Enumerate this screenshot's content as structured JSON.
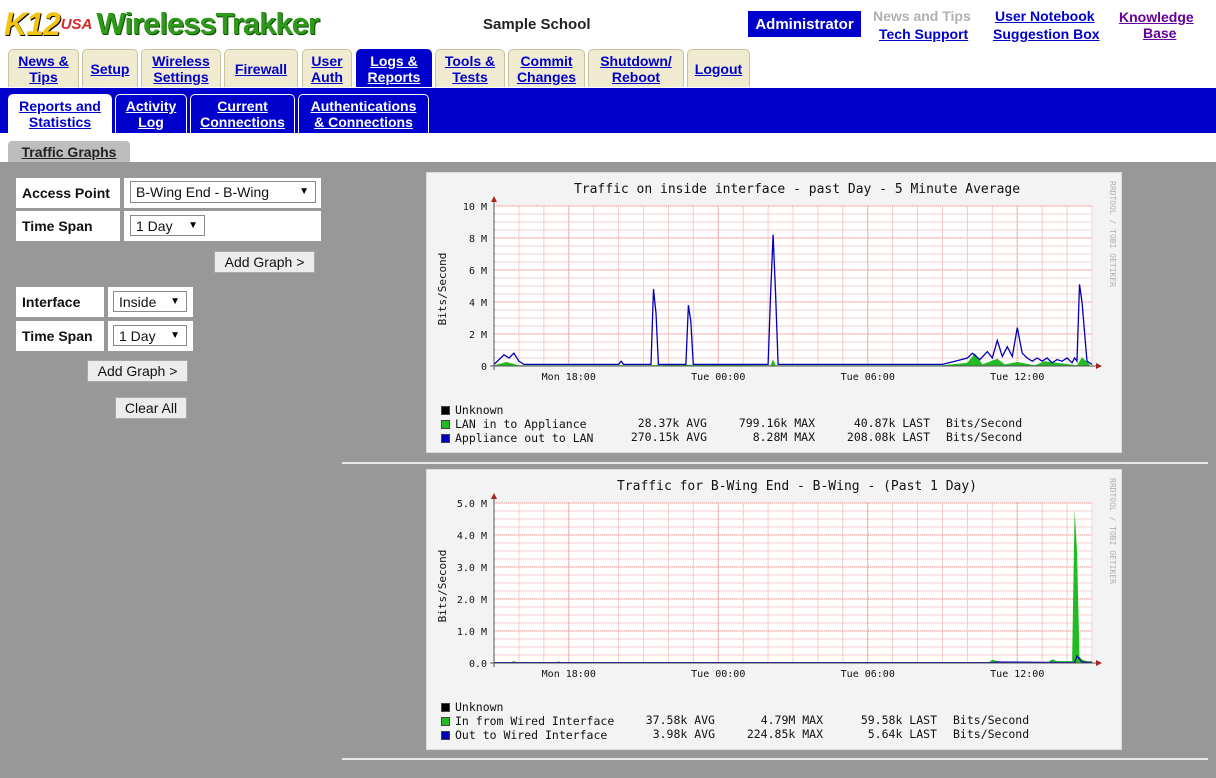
{
  "header": {
    "logo_k12": "K12",
    "logo_usa": "USA",
    "logo_product": "WirelessTrakker",
    "school": "Sample School",
    "user_role": "Administrator",
    "links": {
      "news_tips": "News and Tips",
      "tech_support": "Tech Support",
      "user_notebook": "User Notebook",
      "suggestion_box": "Suggestion Box",
      "knowledge_base_1": "Knowledge",
      "knowledge_base_2": "Base"
    }
  },
  "main_tabs": [
    {
      "line1": "News &",
      "line2": "Tips"
    },
    {
      "line1": "Setup",
      "line2": ""
    },
    {
      "line1": "Wireless",
      "line2": "Settings"
    },
    {
      "line1": "Firewall",
      "line2": ""
    },
    {
      "line1": "User",
      "line2": "Auth"
    },
    {
      "line1": "Logs &",
      "line2": "Reports",
      "active": true
    },
    {
      "line1": "Tools &",
      "line2": "Tests"
    },
    {
      "line1": "Commit",
      "line2": "Changes"
    },
    {
      "line1": "Shutdown/",
      "line2": "Reboot"
    },
    {
      "line1": "Logout",
      "line2": ""
    }
  ],
  "sub_tabs": [
    {
      "line1": "Reports and",
      "line2": "Statistics",
      "active": true
    },
    {
      "line1": "Activity",
      "line2": "Log"
    },
    {
      "line1": "Current",
      "line2": "Connections"
    },
    {
      "line1": "Authentications",
      "line2": "& Connections"
    }
  ],
  "section_tab": "Traffic Graphs",
  "form": {
    "access_point_label": "Access Point",
    "access_point_value": "B-Wing End - B-Wing",
    "time_span_label": "Time Span",
    "time_span_1_value": "1 Day",
    "add_graph_1": "Add Graph >",
    "interface_label": "Interface",
    "interface_value": "Inside",
    "time_span_2_value": "1 Day",
    "add_graph_2": "Add Graph >",
    "clear_all": "Clear All"
  },
  "colors": {
    "brand_blue": "#0000cc",
    "tab_bg": "#f0ebd0",
    "content_bg": "#989898",
    "series_green": "#22bb22",
    "series_blue": "#0000bb",
    "series_black": "#000000",
    "grid_red": "#f0b0b0",
    "axis_red": "#aa2222"
  },
  "chart_data": [
    {
      "type": "area",
      "title": "Traffic on inside interface - past Day - 5 Minute Average",
      "ylabel": "Bits/Second",
      "watermark": "RRDTOOL / TOBI OETIKER",
      "x_ticks": [
        "Mon 18:00",
        "Tue 00:00",
        "Tue 06:00",
        "Tue 12:00"
      ],
      "y_ticks": [
        "0",
        "2 M",
        "4 M",
        "6 M",
        "8 M",
        "10 M"
      ],
      "ylim": [
        0,
        10
      ],
      "xlim": [
        0,
        24
      ],
      "grid": true,
      "legend": [
        {
          "name": "Unknown",
          "color": "#000000",
          "avg": "",
          "max": "",
          "last": "",
          "unit": ""
        },
        {
          "name": "LAN in to Appliance",
          "color": "#22bb22",
          "avg": "28.37k AVG",
          "max": "799.16k MAX",
          "last": "40.87k LAST",
          "unit": "Bits/Second"
        },
        {
          "name": "Appliance out to LAN",
          "color": "#0000bb",
          "avg": "270.15k AVG",
          "max": "8.28M MAX",
          "last": "208.08k LAST",
          "unit": "Bits/Second"
        }
      ],
      "series": [
        {
          "name": "LAN in to Appliance",
          "color": "#22bb22",
          "x": [
            0,
            0.5,
            1.0,
            6.3,
            7.7,
            11.1,
            11.2,
            11.3,
            18.0,
            19.0,
            19.3,
            19.6,
            20.2,
            20.5,
            21.0,
            21.7,
            22.1,
            23.4,
            23.6,
            23.9
          ],
          "values": [
            0.05,
            0.25,
            0.05,
            0.05,
            0.08,
            0.05,
            0.4,
            0.05,
            0.05,
            0.2,
            0.8,
            0.1,
            0.45,
            0.1,
            0.25,
            0.05,
            0.3,
            0.05,
            0.55,
            0.1
          ]
        },
        {
          "name": "Appliance out to LAN",
          "color": "#0000bb",
          "x": [
            0,
            0.4,
            0.6,
            0.8,
            1.0,
            1.2,
            1.4,
            5.0,
            5.1,
            5.2,
            6.3,
            6.4,
            6.5,
            6.6,
            7.7,
            7.8,
            7.9,
            8.0,
            11.0,
            11.1,
            11.2,
            11.3,
            11.4,
            14.0,
            17.0,
            18.0,
            18.5,
            19.0,
            19.2,
            19.5,
            19.8,
            20.0,
            20.2,
            20.4,
            20.6,
            20.8,
            21.0,
            21.2,
            21.4,
            21.6,
            21.8,
            22.0,
            22.2,
            22.4,
            22.6,
            22.8,
            23.0,
            23.2,
            23.3,
            23.4,
            23.5,
            23.6,
            23.8,
            24.0
          ],
          "values": [
            0.1,
            0.7,
            0.5,
            0.8,
            0.3,
            0.1,
            0.1,
            0.1,
            0.3,
            0.1,
            0.1,
            4.8,
            3.3,
            0.1,
            0.1,
            3.8,
            2.8,
            0.1,
            0.1,
            4.5,
            8.2,
            4.5,
            0.1,
            0.1,
            0.1,
            0.1,
            0.3,
            0.5,
            0.8,
            0.4,
            0.9,
            0.5,
            1.6,
            0.6,
            1.2,
            0.6,
            2.4,
            0.8,
            0.5,
            0.3,
            0.5,
            0.3,
            0.5,
            0.2,
            0.4,
            0.3,
            0.5,
            0.2,
            0.5,
            0.3,
            5.1,
            4.0,
            0.3,
            0.1
          ]
        }
      ]
    },
    {
      "type": "area",
      "title": "Traffic for B-Wing End - B-Wing - (Past 1 Day)",
      "ylabel": "Bits/Second",
      "watermark": "RRDTOOL / TOBI OETIKER",
      "x_ticks": [
        "Mon 18:00",
        "Tue 00:00",
        "Tue 06:00",
        "Tue 12:00"
      ],
      "y_ticks": [
        "0.0",
        "1.0 M",
        "2.0 M",
        "3.0 M",
        "4.0 M",
        "5.0 M"
      ],
      "ylim": [
        0,
        5
      ],
      "xlim": [
        0,
        24
      ],
      "grid": true,
      "legend": [
        {
          "name": "Unknown",
          "color": "#000000",
          "avg": "",
          "max": "",
          "last": "",
          "unit": ""
        },
        {
          "name": "In from Wired Interface",
          "color": "#22bb22",
          "avg": "37.58k AVG",
          "max": "4.79M MAX",
          "last": "59.58k LAST",
          "unit": "Bits/Second"
        },
        {
          "name": "Out to Wired Interface",
          "color": "#0000bb",
          "avg": "3.98k AVG",
          "max": "224.85k MAX",
          "last": "5.64k LAST",
          "unit": "Bits/Second"
        }
      ],
      "series": [
        {
          "name": "In from Wired Interface",
          "color": "#22bb22",
          "x": [
            0,
            0.6,
            0.8,
            1.0,
            2.4,
            2.6,
            2.8,
            7.8,
            8.0,
            8.2,
            11.0,
            11.2,
            15.0,
            15.2,
            19.8,
            20.0,
            20.2,
            20.4,
            22.2,
            22.4,
            22.6,
            23.2,
            23.3,
            23.4,
            23.5,
            23.6,
            23.8,
            24.0
          ],
          "values": [
            0.0,
            0.0,
            0.06,
            0.0,
            0.0,
            0.05,
            0.0,
            0.0,
            0.04,
            0.0,
            0.0,
            0.03,
            0.0,
            0.03,
            0.0,
            0.1,
            0.06,
            0.0,
            0.0,
            0.12,
            0.06,
            0.06,
            4.79,
            3.5,
            0.2,
            0.1,
            0.06,
            0.06
          ]
        },
        {
          "name": "Out to Wired Interface",
          "color": "#0000bb",
          "x": [
            0,
            20.0,
            20.2,
            23.3,
            23.4,
            23.6,
            24.0
          ],
          "values": [
            0.01,
            0.01,
            0.03,
            0.01,
            0.22,
            0.03,
            0.01
          ]
        }
      ]
    }
  ]
}
